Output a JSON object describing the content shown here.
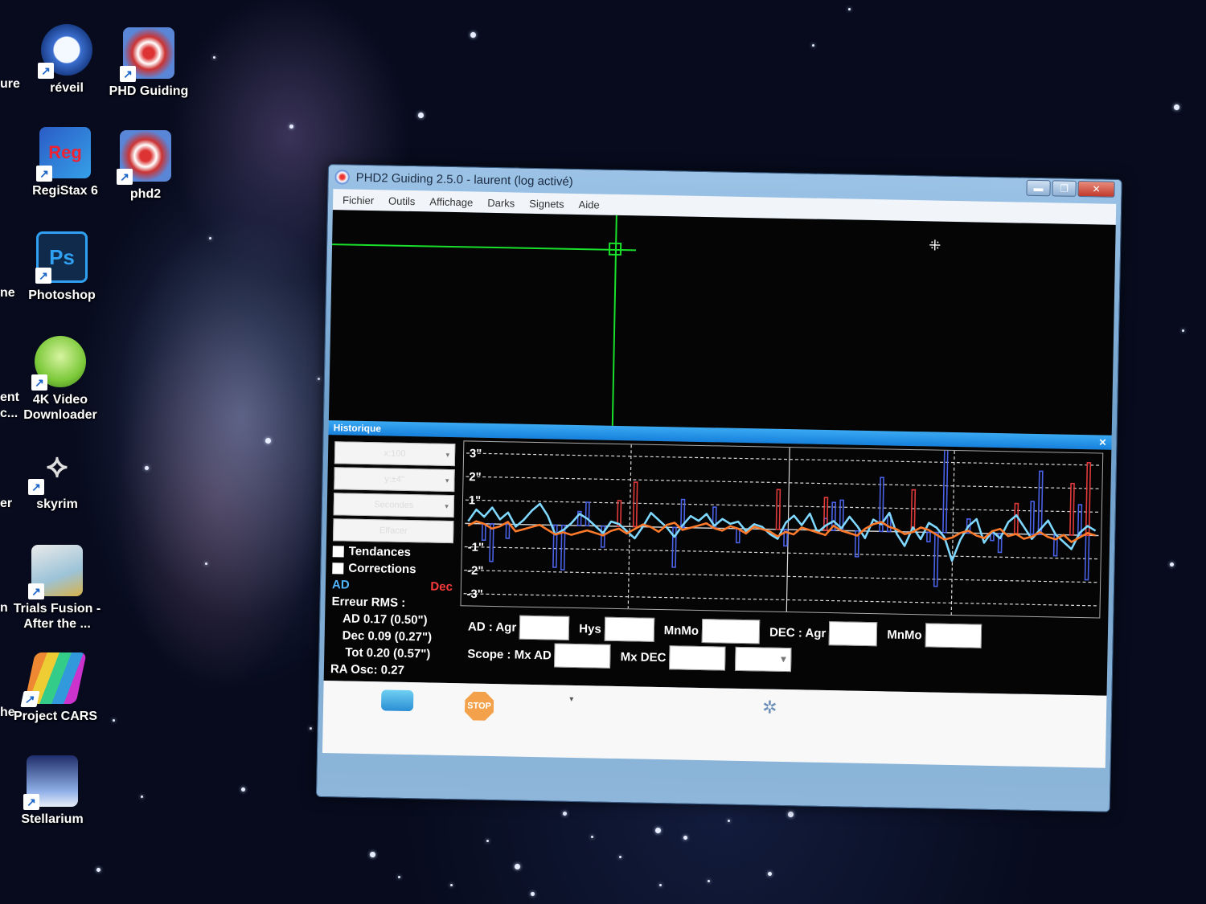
{
  "desktop": {
    "edge_labels": [
      "ure",
      "ne",
      "ent",
      "c...",
      "er",
      "n",
      "he"
    ],
    "icons": [
      {
        "label": "réveil",
        "icon": "clock-icon"
      },
      {
        "label": "PHD Guiding",
        "icon": "phd-target-icon"
      },
      {
        "label": "RegiStax 6",
        "icon": "registax-icon"
      },
      {
        "label": "phd2",
        "icon": "phd-target-icon"
      },
      {
        "label": "Photoshop",
        "icon": "photoshop-icon",
        "glyph": "Ps"
      },
      {
        "label": "4K Video Downloader",
        "icon": "4k-video-downloader-icon"
      },
      {
        "label": "skyrim",
        "icon": "skyrim-icon"
      },
      {
        "label": "Trials Fusion - After the ...",
        "icon": "trials-fusion-icon"
      },
      {
        "label": "Project CARS",
        "icon": "project-cars-icon"
      },
      {
        "label": "Stellarium",
        "icon": "stellarium-icon"
      }
    ]
  },
  "window": {
    "title": "PHD2 Guiding 2.5.0 - laurent (log activé)",
    "controls": {
      "minimize": "▬",
      "maximize": "❐",
      "close": "✕"
    },
    "menu": [
      "Fichier",
      "Outils",
      "Affichage",
      "Darks",
      "Signets",
      "Aide"
    ],
    "busy_icon": "loading-icon"
  },
  "history": {
    "title": "Historique",
    "close": "✕",
    "combo_values": [
      "x:100",
      "y:±4\"",
      "Secondes",
      "Effacer"
    ],
    "trends_label": "Tendances",
    "corrections_label": "Corrections",
    "ad_label": "AD",
    "dec_label": "Dec",
    "rms": {
      "heading": "Erreur RMS :",
      "ad": "AD 0.17 (0.50\")",
      "dec": "Dec 0.09 (0.27\")",
      "tot": "Tot 0.20 (0.57\")",
      "ra_osc": "RA Osc: 0.27"
    },
    "params": {
      "ad_agr": "AD : Agr",
      "hys": "Hys",
      "mnmo": "MnMo",
      "dec_agr": "DEC : Agr",
      "dec_mnmo": "MnMo",
      "scope_mx_ad": "Scope : Mx AD",
      "mx_dec": "Mx DEC"
    }
  },
  "toolbar": {
    "stop_label": "STOP"
  },
  "chart_data": {
    "type": "line",
    "y_tick_labels": [
      "3\"",
      "2\"",
      "1\"",
      "-1\"",
      "-2\"",
      "-3\""
    ],
    "ylim": [
      -3.5,
      3.5
    ],
    "grid": true,
    "x": [
      1,
      2,
      3,
      4,
      5,
      6,
      7,
      8,
      9,
      10,
      11,
      12,
      13,
      14,
      15,
      16,
      17,
      18,
      19,
      20,
      21,
      22,
      23,
      24,
      25,
      26,
      27,
      28,
      29,
      30,
      31,
      32,
      33,
      34,
      35,
      36,
      37,
      38,
      39,
      40,
      41,
      42,
      43,
      44,
      45,
      46,
      47,
      48,
      49,
      50,
      51,
      52,
      53,
      54,
      55,
      56,
      57,
      58,
      59,
      60,
      61,
      62,
      63,
      64,
      65,
      66,
      67,
      68,
      69,
      70,
      71,
      72,
      73,
      74,
      75,
      76,
      77,
      78,
      79,
      80
    ],
    "series": [
      {
        "name": "AD",
        "color": "#7fd8ff",
        "values": [
          0.1,
          0.6,
          0.3,
          0.7,
          0.2,
          0.5,
          -0.1,
          0.2,
          0.6,
          0.9,
          0.4,
          -0.4,
          -0.2,
          0.1,
          0.5,
          0.3,
          0.0,
          -0.3,
          0.2,
          0.1,
          -0.2,
          -0.5,
          0.0,
          0.6,
          0.3,
          0.0,
          -0.4,
          0.1,
          0.5,
          0.3,
          0.6,
          0.1,
          0.4,
          0.2,
          0.3,
          -0.1,
          0.2,
          0.1,
          -0.2,
          -0.4,
          0.3,
          0.6,
          0.2,
          0.7,
          -0.1,
          0.2,
          0.4,
          0.1,
          0.6,
          0.2,
          -0.3,
          0.5,
          0.3,
          0.8,
          -0.1,
          -0.6,
          0.2,
          -0.3,
          0.4,
          0.2,
          -0.2,
          -1.2,
          -0.3,
          0.3,
          0.6,
          -0.4,
          0.1,
          -0.2,
          0.5,
          0.8,
          0.3,
          -0.2,
          0.2,
          0.6,
          0.0,
          -0.3,
          -0.6,
          0.1,
          0.4,
          0.2
        ]
      },
      {
        "name": "Dec",
        "color": "#ff7a2a",
        "values": [
          -0.1,
          0.1,
          0.0,
          -0.2,
          -0.1,
          0.1,
          -0.3,
          -0.2,
          -0.1,
          0.0,
          -0.2,
          -0.4,
          -0.3,
          -0.4,
          -0.3,
          -0.2,
          -0.3,
          -0.4,
          -0.2,
          -0.1,
          -0.3,
          -0.1,
          0.1,
          0.0,
          -0.2,
          0.1,
          0.2,
          -0.1,
          0.0,
          0.1,
          0.2,
          0.0,
          -0.1,
          0.1,
          0.0,
          -0.2,
          0.1,
          0.0,
          -0.1,
          -0.3,
          -0.1,
          -0.2,
          0.1,
          0.0,
          -0.1,
          -0.2,
          0.2,
          0.0,
          -0.1,
          -0.2,
          0.1,
          0.3,
          0.4,
          0.2,
          0.1,
          -0.1,
          0.0,
          0.2,
          0.1,
          -0.1,
          -0.3,
          -0.2,
          0.0,
          0.1,
          -0.1,
          -0.2,
          0.1,
          0.2,
          -0.1,
          0.0,
          -0.2,
          -0.1,
          0.1,
          -0.1,
          -0.2,
          0.0,
          -0.3,
          -0.1,
          0.1,
          0.0
        ]
      }
    ],
    "ra_corrections": [
      [
        3,
        -0.7
      ],
      [
        4,
        -1.6
      ],
      [
        6,
        -0.6
      ],
      [
        12,
        -1.8
      ],
      [
        13,
        -1.9
      ],
      [
        15,
        0.6
      ],
      [
        16,
        1.0
      ],
      [
        18,
        -0.9
      ],
      [
        27,
        -1.7
      ],
      [
        28,
        1.2
      ],
      [
        32,
        0.9
      ],
      [
        35,
        -0.6
      ],
      [
        41,
        -0.7
      ],
      [
        46,
        0.5
      ],
      [
        47,
        1.2
      ],
      [
        48,
        1.3
      ],
      [
        50,
        -1.1
      ],
      [
        53,
        2.3
      ],
      [
        54,
        0.7
      ],
      [
        59,
        -0.4
      ],
      [
        60,
        -2.3
      ],
      [
        61,
        3.7
      ],
      [
        64,
        0.6
      ],
      [
        67,
        -0.3
      ],
      [
        68,
        -0.8
      ],
      [
        72,
        1.4
      ],
      [
        73,
        2.7
      ],
      [
        75,
        -0.9
      ],
      [
        78,
        1.3
      ],
      [
        79,
        -1.9
      ]
    ],
    "dec_corrections": [
      [
        20,
        1.1
      ],
      [
        22,
        1.9
      ],
      [
        40,
        1.7
      ],
      [
        46,
        1.4
      ],
      [
        57,
        1.8
      ],
      [
        70,
        1.3
      ],
      [
        77,
        2.2
      ],
      [
        79,
        3.1
      ]
    ]
  }
}
